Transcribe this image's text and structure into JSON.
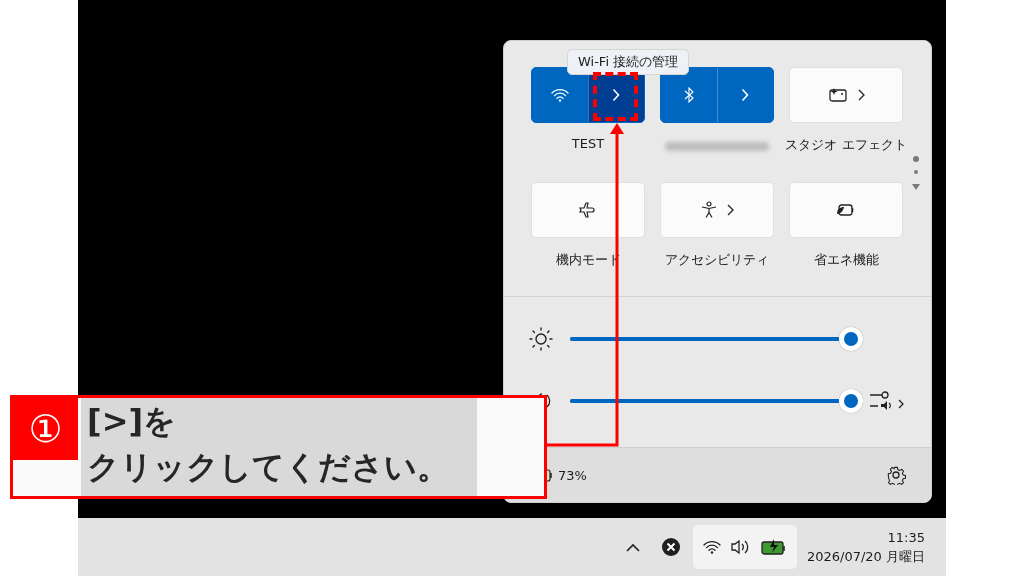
{
  "quick_settings": {
    "tooltip": "Wi-Fi 接続の管理",
    "tiles": [
      {
        "kind": "split",
        "label": "TEST",
        "on": true,
        "hovered": true
      },
      {
        "kind": "split",
        "on": true,
        "hovered": false
      },
      {
        "kind": "chevron",
        "label": "スタジオ エフェクト",
        "on": false
      },
      {
        "kind": "plain",
        "label": "機内モード",
        "on": false
      },
      {
        "kind": "chevron",
        "label": "アクセシビリティ",
        "on": false
      },
      {
        "kind": "plain",
        "label": "省エネ機能",
        "on": false
      }
    ],
    "sliders": [
      {
        "level": 1
      },
      {
        "level": 1
      }
    ],
    "battery": "73%"
  },
  "taskbar": {
    "time": "11:35",
    "date": "2026/07/20 月曜日"
  },
  "annotation": {
    "number": "①",
    "lines": [
      "[>]を",
      "クリックしてください。"
    ]
  }
}
